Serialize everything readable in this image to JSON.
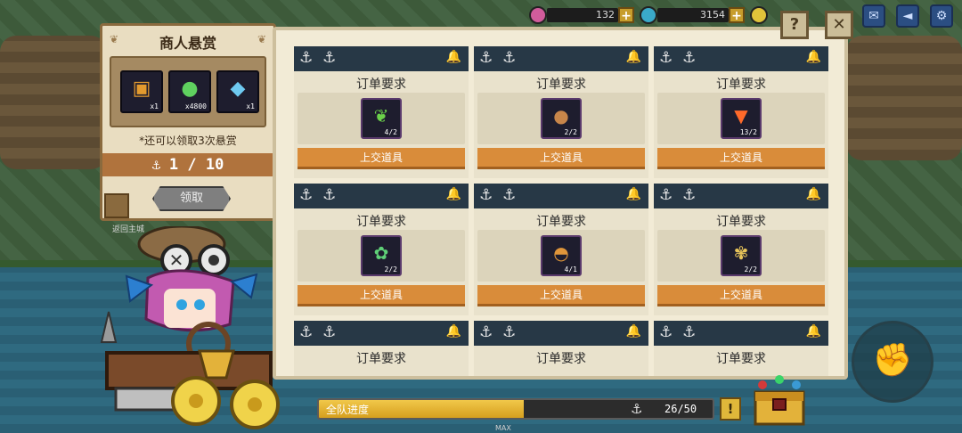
{
  "resources": [
    {
      "name": "gem",
      "value": "132",
      "color": "#d15c9b"
    },
    {
      "name": "crystal",
      "value": "3154",
      "color": "#3aa9c9"
    },
    {
      "name": "gold",
      "value": "",
      "color": "#e0c23a"
    }
  ],
  "top_buttons": [
    "mail-icon",
    "sound-icon",
    "settings-icon"
  ],
  "merchant": {
    "title": "商人悬赏",
    "rewards": [
      {
        "icon": "chest-icon",
        "qty": "x1"
      },
      {
        "icon": "orbs-icon",
        "qty": "x4800"
      },
      {
        "icon": "crystal-icon",
        "qty": "x1"
      }
    ],
    "remaining_text": "*还可以领取3次悬赏",
    "progress_text": "1 / 10",
    "claim_label": "领取",
    "back_label": "返回主城"
  },
  "orders": [
    {
      "title": "订单要求",
      "item": "lettuce-icon",
      "qty": "4/2",
      "button": "上交道具",
      "has_item": true
    },
    {
      "title": "订单要求",
      "item": "walnut-icon",
      "qty": "2/2",
      "button": "上交道具",
      "has_item": true
    },
    {
      "title": "订单要求",
      "item": "carrot-icon",
      "qty": "13/2",
      "button": "上交道具",
      "has_item": true
    },
    {
      "title": "订单要求",
      "item": "cabbage-icon",
      "qty": "2/2",
      "button": "上交道具",
      "has_item": true
    },
    {
      "title": "订单要求",
      "item": "burger-icon",
      "qty": "4/1",
      "button": "上交道具",
      "has_item": true
    },
    {
      "title": "订单要求",
      "item": "grain-icon",
      "qty": "2/2",
      "button": "上交道具",
      "has_item": true
    },
    {
      "title": "订单要求",
      "has_item": false
    },
    {
      "title": "订单要求",
      "has_item": false
    },
    {
      "title": "订单要求",
      "has_item": false
    }
  ],
  "team": {
    "label": "全队进度",
    "count": "26/50",
    "progress": 0.52,
    "max_label": "MAX"
  },
  "help_label": "?",
  "close_label": "✕"
}
